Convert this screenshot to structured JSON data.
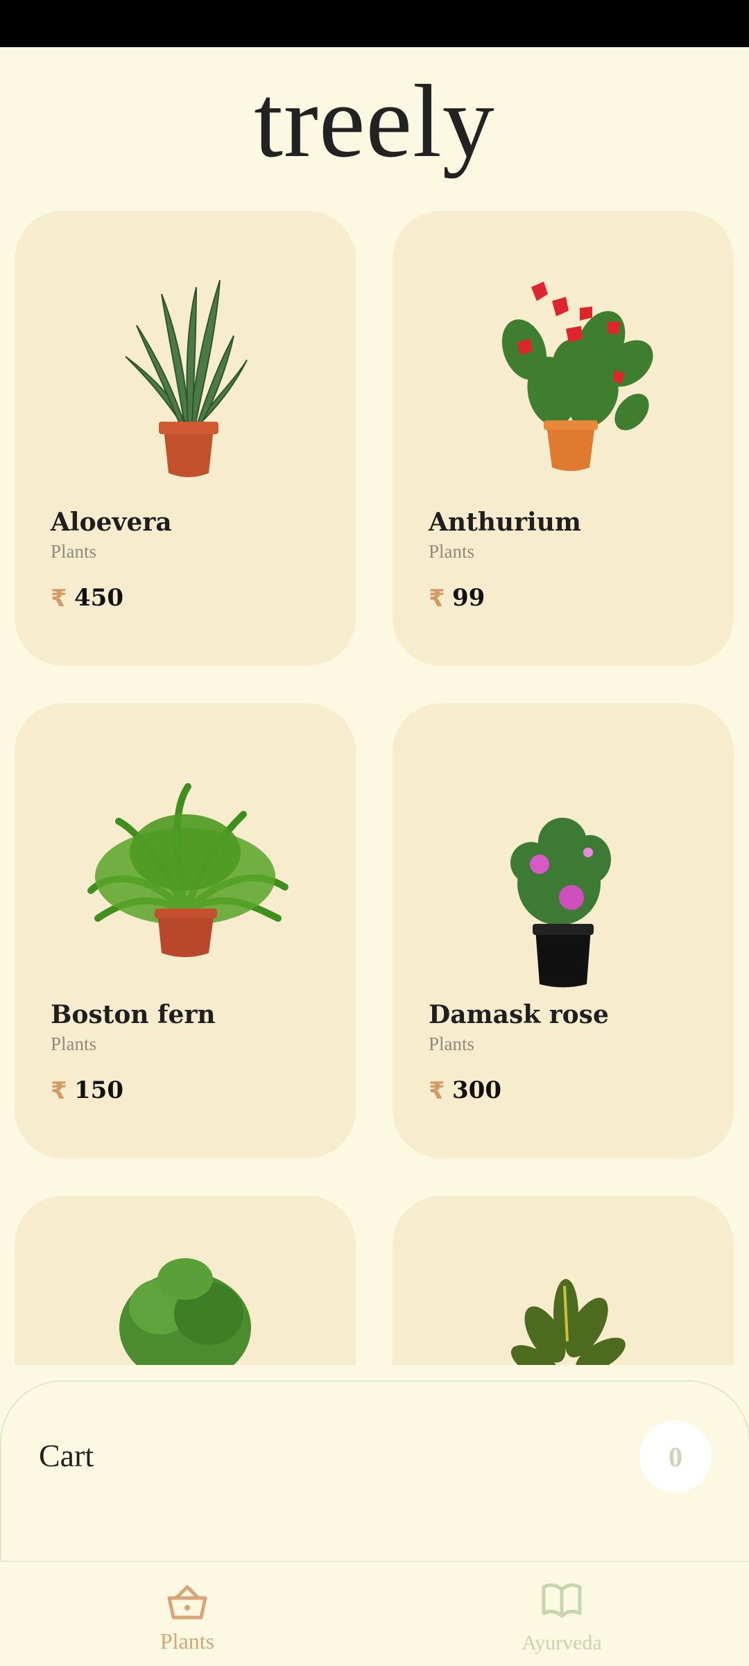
{
  "app": {
    "title": "treely"
  },
  "products": [
    {
      "name": "Aloevera",
      "category": "Plants",
      "currency": "₹",
      "price": "450",
      "icon": "aloe-plant"
    },
    {
      "name": "Anthurium",
      "category": "Plants",
      "currency": "₹",
      "price": "99",
      "icon": "anthurium-plant"
    },
    {
      "name": "Boston fern",
      "category": "Plants",
      "currency": "₹",
      "price": "150",
      "icon": "fern-plant"
    },
    {
      "name": "Damask rose",
      "category": "Plants",
      "currency": "₹",
      "price": "300",
      "icon": "rose-plant"
    },
    {
      "name": "",
      "category": "",
      "currency": "",
      "price": "",
      "icon": "ficus-plant"
    },
    {
      "name": "",
      "category": "",
      "currency": "",
      "price": "",
      "icon": "croton-plant"
    }
  ],
  "cart": {
    "label": "Cart",
    "count": "0"
  },
  "nav": {
    "items": [
      {
        "label": "Plants",
        "icon": "basket-icon",
        "active": true,
        "color": "#d9a577"
      },
      {
        "label": "Ayurveda",
        "icon": "book-icon",
        "active": false,
        "color": "#c8d6b0"
      }
    ]
  },
  "colors": {
    "background": "#fcf8e1",
    "card": "#f8ecce",
    "accent": "#d39a63"
  }
}
